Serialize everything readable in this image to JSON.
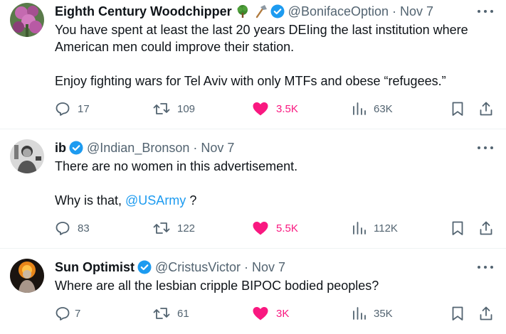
{
  "colors": {
    "verified": "#1d9bf0",
    "like": "#f91880",
    "secondary_text": "#536471",
    "mention": "#1d9bf0"
  },
  "tweets": [
    {
      "author_name": "Eighth Century Woodchipper",
      "author_emojis": [
        "tree-icon",
        "axe-icon"
      ],
      "verified": true,
      "handle": "@BonifaceOption",
      "separator": "·",
      "date": "Nov 7",
      "paragraphs": [
        "You have spent at least the last 20 years DEIing the last institution where American men could improve their station.",
        "Enjoy fighting wars for Tel Aviv with only MTFs and obese “refugees.”"
      ],
      "replies": "17",
      "reposts": "109",
      "likes": "3.5K",
      "views": "63K"
    },
    {
      "author_name": "ib",
      "verified": true,
      "handle": "@Indian_Bronson",
      "separator": "·",
      "date": "Nov 7",
      "paragraph1": "There are no women in this advertisement.",
      "paragraph2_before": "Why is that, ",
      "paragraph2_mention": "@USArmy",
      "paragraph2_after": " ?",
      "replies": "83",
      "reposts": "122",
      "likes": "5.5K",
      "views": "112K"
    },
    {
      "author_name": "Sun Optimist",
      "verified": true,
      "handle": "@CristusVictor",
      "separator": "·",
      "date": "Nov 7",
      "paragraphs": [
        "Where are all the lesbian cripple BIPOC bodied peoples?"
      ],
      "replies": "7",
      "reposts": "61",
      "likes": "3K",
      "views": "35K"
    }
  ]
}
